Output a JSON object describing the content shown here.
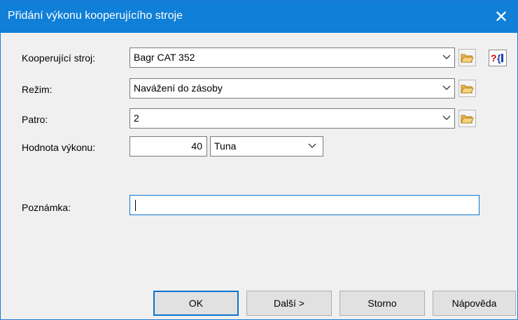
{
  "window": {
    "title": "Přidání výkonu kooperujícího stroje",
    "close_icon": "close-icon"
  },
  "form": {
    "machine": {
      "label": "Kooperující stroj:",
      "value": "Bagr CAT 352"
    },
    "mode": {
      "label": "Režim:",
      "value": "Navážení do zásoby"
    },
    "floor": {
      "label": "Patro:",
      "value": "2"
    },
    "performance": {
      "label": "Hodnota výkonu:",
      "value": "40",
      "unit": "Tuna"
    },
    "note": {
      "label": "Poznámka:",
      "value": ""
    }
  },
  "icons": {
    "folder": "folder-icon",
    "help": "help-icon",
    "dropdown": "chevron-down-icon"
  },
  "buttons": {
    "ok": "OK",
    "next": "Další >",
    "cancel": "Storno",
    "help": "Nápověda"
  },
  "colors": {
    "titlebar": "#0f7fd8",
    "focus": "#0a74d0"
  }
}
